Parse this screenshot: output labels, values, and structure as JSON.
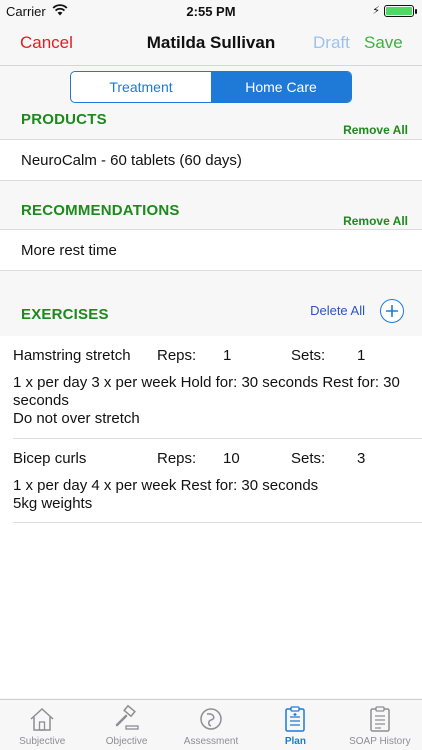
{
  "status": {
    "carrier": "Carrier",
    "time": "2:55 PM"
  },
  "nav": {
    "cancel": "Cancel",
    "title": "Matilda Sullivan",
    "draft": "Draft",
    "save": "Save"
  },
  "segments": {
    "treatment": "Treatment",
    "home_care": "Home Care",
    "selected": "Home Care"
  },
  "products": {
    "title": "PRODUCTS",
    "remove_all": "Remove All",
    "items": [
      "NeuroCalm - 60 tablets (60 days)"
    ]
  },
  "recommendations": {
    "title": "RECOMMENDATIONS",
    "remove_all": "Remove All",
    "items": [
      "More rest time"
    ]
  },
  "exercises": {
    "title": "EXERCISES",
    "delete_all": "Delete All",
    "add_icon": "plus-circle-icon",
    "reps_label": "Reps:",
    "sets_label": "Sets:",
    "items": [
      {
        "name": "Hamstring stretch",
        "reps": "1",
        "sets": "1",
        "detail": "1 x per day  3 x per week  Hold for: 30 seconds  Rest for: 30 seconds",
        "note": "Do not over stretch"
      },
      {
        "name": "Bicep curls",
        "reps": "10",
        "sets": "3",
        "detail": "1 x per day  4 x per week  Rest for: 30 seconds",
        "note": "5kg weights"
      }
    ]
  },
  "tabs": [
    {
      "label": "Subjective",
      "icon": "house-icon"
    },
    {
      "label": "Objective",
      "icon": "gavel-icon"
    },
    {
      "label": "Assessment",
      "icon": "assessment-icon"
    },
    {
      "label": "Plan",
      "icon": "clipboard-icon"
    },
    {
      "label": "SOAP History",
      "icon": "clipboard-history-icon"
    }
  ],
  "colors": {
    "accent_blue": "#1e7ad6",
    "cancel_red": "#e02020",
    "save_green": "#3eb23e",
    "section_green": "#1d8a1d",
    "draft_blue": "#9cc3ec"
  }
}
